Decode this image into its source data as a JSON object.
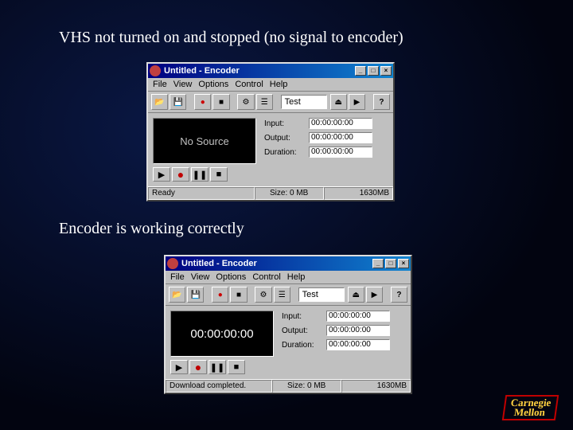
{
  "captions": {
    "no_signal": "VHS not turned on and stopped (no signal to encoder)",
    "working": "Encoder is working correctly"
  },
  "window": {
    "title": "Untitled - Encoder",
    "menu": {
      "file": "File",
      "view": "View",
      "options": "Options",
      "control": "Control",
      "help": "Help"
    },
    "toolbar_input": "Test",
    "stats": {
      "input_label": "Input:",
      "output_label": "Output:",
      "duration_label": "Duration:",
      "zero": "00:00:00:00"
    },
    "preview_no_source": "No Source",
    "preview_timecode": "00:00:00:00",
    "status": {
      "ready": "Ready",
      "download_complete": "Download completed.",
      "size": "Size: 0 MB",
      "rate": "1630MB"
    }
  },
  "footer": {
    "cmu1": "Carnegie",
    "cmu2": "Mellon"
  }
}
